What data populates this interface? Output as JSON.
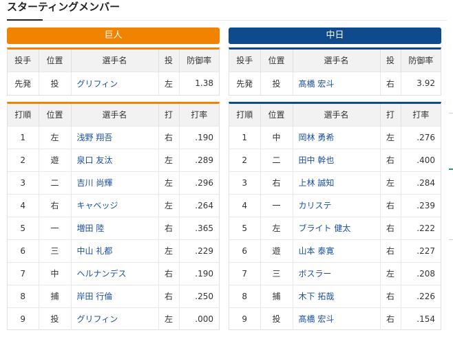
{
  "heading": "スターティングメンバー",
  "teams": {
    "left": "巨人",
    "right": "中日"
  },
  "pitcher_headers": [
    "投手",
    "位置",
    "選手名",
    "投",
    "防御率"
  ],
  "batter_headers": [
    "打順",
    "位置",
    "選手名",
    "打",
    "打率"
  ],
  "left_pitcher": {
    "role": "先発",
    "pos": "投",
    "name": "グリフィン",
    "hand": "左",
    "era": "1.38"
  },
  "right_pitcher": {
    "role": "先発",
    "pos": "投",
    "name": "髙橋 宏斗",
    "hand": "右",
    "era": "3.92"
  },
  "left_batters": [
    {
      "order": "1",
      "pos": "左",
      "name": "浅野 翔吾",
      "bat": "右",
      "avg": ".190"
    },
    {
      "order": "2",
      "pos": "遊",
      "name": "泉口 友汰",
      "bat": "左",
      "avg": ".289"
    },
    {
      "order": "3",
      "pos": "二",
      "name": "吉川 尚輝",
      "bat": "左",
      "avg": ".296"
    },
    {
      "order": "4",
      "pos": "右",
      "name": "キャベッジ",
      "bat": "左",
      "avg": ".264"
    },
    {
      "order": "5",
      "pos": "一",
      "name": "増田 陸",
      "bat": "右",
      "avg": ".365"
    },
    {
      "order": "6",
      "pos": "三",
      "name": "中山 礼都",
      "bat": "左",
      "avg": ".229"
    },
    {
      "order": "7",
      "pos": "中",
      "name": "ヘルナンデス",
      "bat": "右",
      "avg": ".190"
    },
    {
      "order": "8",
      "pos": "捕",
      "name": "岸田 行倫",
      "bat": "右",
      "avg": ".250"
    },
    {
      "order": "9",
      "pos": "投",
      "name": "グリフィン",
      "bat": "左",
      "avg": ".000"
    }
  ],
  "right_batters": [
    {
      "order": "1",
      "pos": "中",
      "name": "岡林 勇希",
      "bat": "左",
      "avg": ".276"
    },
    {
      "order": "2",
      "pos": "二",
      "name": "田中 幹也",
      "bat": "右",
      "avg": ".400"
    },
    {
      "order": "3",
      "pos": "右",
      "name": "上林 誠知",
      "bat": "左",
      "avg": ".284"
    },
    {
      "order": "4",
      "pos": "一",
      "name": "カリステ",
      "bat": "右",
      "avg": ".239"
    },
    {
      "order": "5",
      "pos": "左",
      "name": "ブライト 健太",
      "bat": "右",
      "avg": ".222"
    },
    {
      "order": "6",
      "pos": "遊",
      "name": "山本 泰寛",
      "bat": "右",
      "avg": ".227"
    },
    {
      "order": "7",
      "pos": "三",
      "name": "ボスラー",
      "bat": "左",
      "avg": ".208"
    },
    {
      "order": "8",
      "pos": "捕",
      "name": "木下 拓哉",
      "bat": "右",
      "avg": ".226"
    },
    {
      "order": "9",
      "pos": "投",
      "name": "髙橋 宏斗",
      "bat": "右",
      "avg": ".154"
    }
  ]
}
